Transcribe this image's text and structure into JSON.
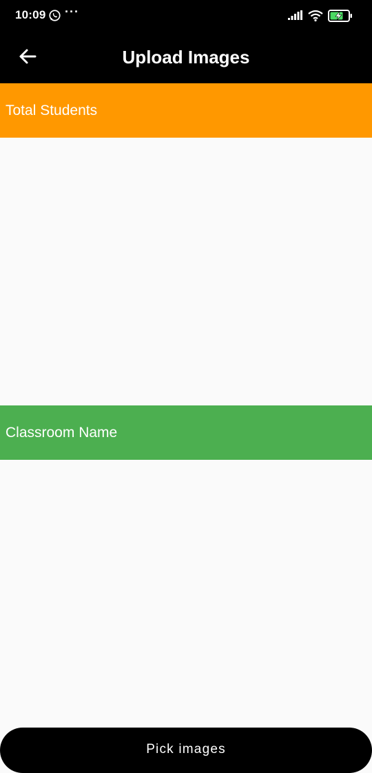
{
  "status_bar": {
    "time": "10:09",
    "more_indicator": "···",
    "icons": [
      "whatsapp-icon",
      "signal-icon",
      "wifi-icon",
      "battery-charging-icon"
    ]
  },
  "app_bar": {
    "title": "Upload Images",
    "back_icon": "arrow-back-icon",
    "background": "#000000"
  },
  "sections": {
    "students": {
      "label": "Total Students",
      "color": "#ff9800"
    },
    "classroom": {
      "label": "Classroom Name",
      "color": "#4caf50"
    }
  },
  "actions": {
    "pick_images_label": "Pick images"
  }
}
